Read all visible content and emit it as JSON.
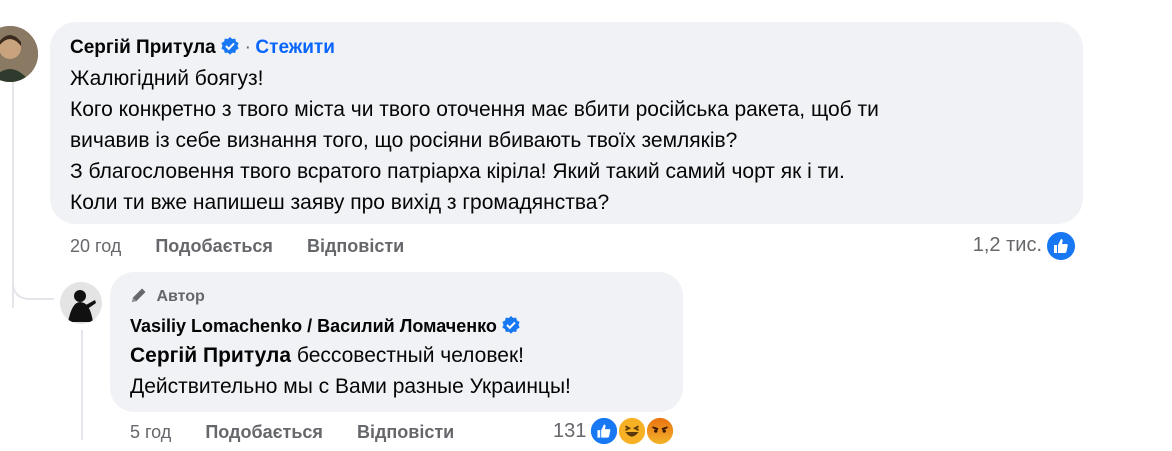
{
  "comment1": {
    "author": "Сергій Притула",
    "follow_label": "Стежити",
    "lines": [
      "Жалюгідний боягуз!",
      "Кого конкретно з твого міста чи твого оточення має вбити російська ракета, щоб ти",
      "вичавив із себе визнання того, що росіяни вбивають твоїх земляків?",
      "З благословення твого всратого патріарха кіріла! Який такий самий чорт як і ти.",
      "Коли ти вже напишеш заяву про вихід з громадянства?"
    ],
    "time": "20 год",
    "like_label": "Подобається",
    "reply_label": "Відповісти",
    "reactions_count": "1,2 тис."
  },
  "reply1": {
    "author_badge": "Автор",
    "author": "Vasiliy Lomachenko / Василий Ломаченко",
    "mention": "Сергій Притула",
    "line1_rest": " бессовестный человек!",
    "line2": "Действительно мы с Вами разные Украинцы!",
    "time": "5 год",
    "like_label": "Подобається",
    "reply_label": "Відповісти",
    "reactions_count": "131"
  },
  "colors": {
    "bubble": "#f0f2f5",
    "link_blue": "#0866ff",
    "meta_gray": "#65676b",
    "verified_blue": "#1877f2"
  },
  "icons": [
    "verified-badge-icon",
    "like-icon",
    "haha-icon",
    "angry-icon",
    "pencil-icon"
  ]
}
